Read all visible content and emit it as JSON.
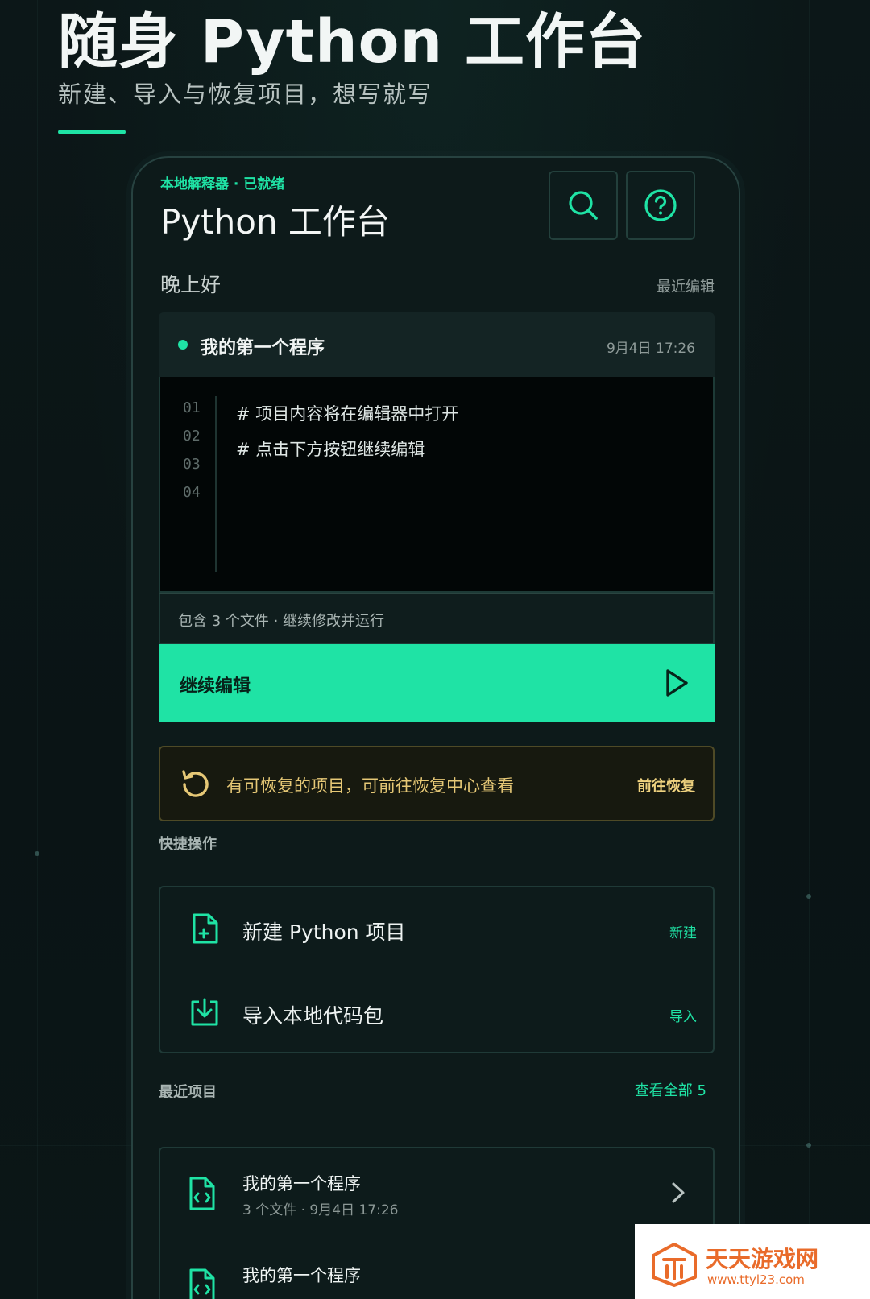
{
  "hero": {
    "title": "随身 Python 工作台",
    "subtitle": "新建、导入与恢复项目，想写就写"
  },
  "header": {
    "status": "本地解释器 · 已就绪",
    "title": "Python 工作台",
    "search_icon": "search-icon",
    "help_icon": "help-circle-icon"
  },
  "greeting": {
    "text": "晚上好",
    "recent_label": "最近编辑"
  },
  "current_project": {
    "name": "我的第一个程序",
    "time": "9月4日  17:26",
    "line_numbers": [
      "01",
      "02",
      "03",
      "04"
    ],
    "code_lines": [
      "#  项目内容将在编辑器中打开",
      "#  点击下方按钮继续编辑"
    ],
    "meta": "包含  3  个文件  ·  继续修改并运行",
    "continue_label": "继续编辑"
  },
  "restore": {
    "text": "有可恢复的项目，可前往恢复中心查看",
    "action": "前往恢复"
  },
  "quick_actions": {
    "label": "快捷操作",
    "items": [
      {
        "title": "新建 Python 项目",
        "tag": "新建",
        "icon": "file-plus-icon"
      },
      {
        "title": "导入本地代码包",
        "tag": "导入",
        "icon": "download-tray-icon"
      }
    ]
  },
  "recent_projects": {
    "label": "最近项目",
    "view_all": "查看全部  5",
    "items": [
      {
        "name": "我的第一个程序",
        "meta": "3 个文件 · 9月4日 17:26"
      },
      {
        "name": "我的第一个程序",
        "meta": ""
      }
    ]
  },
  "watermark": {
    "name": "天天游戏网",
    "url": "www.ttyl23.com"
  },
  "colors": {
    "accent": "#1fe3a5",
    "background": "#0b1516",
    "warning": "#e6c876"
  }
}
